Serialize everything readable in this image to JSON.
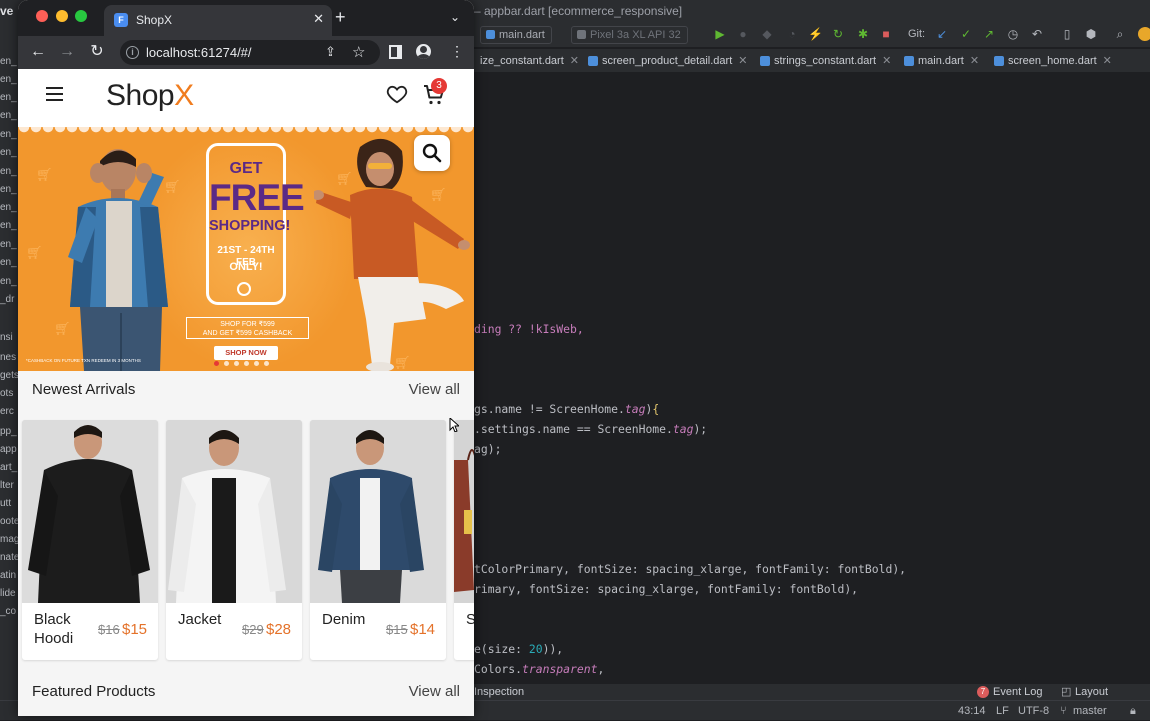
{
  "ide": {
    "title_left": "ve",
    "title": "– appbar.dart [ecommerce_responsive]",
    "run_config": "main.dart",
    "device": "Pixel 3a XL API 32",
    "git_label": "Git:",
    "tabs": [
      "ize_constant.dart",
      "screen_product_detail.dart",
      "strings_constant.dart",
      "main.dart",
      "screen_home.dart"
    ],
    "left_rows": [
      "en_",
      "en_",
      "en_",
      "en_",
      "en_",
      "en_",
      "en_",
      "en_",
      "en_",
      "en_",
      "en_",
      "en_",
      "en_",
      "_dr",
      "",
      "nsi",
      "nes",
      "gets",
      "ots",
      "erc",
      "pp_",
      "app",
      "art_",
      "lter",
      "utt",
      "oote",
      "mag",
      "nate",
      "atin",
      "lide",
      "_co"
    ],
    "code_lines": [
      {
        "parts": [
          [
            "ding ?? !kIsWeb,",
            "k-purple",
            ""
          ]
        ]
      },
      {
        "parts": [
          [
            "gs.name != ScreenHome.",
            ""
          ],
          [
            "tag",
            "k-it"
          ],
          [
            ")",
            ""
          ],
          [
            "{",
            "k-yel"
          ]
        ]
      },
      {
        "parts": [
          [
            ".settings.name == ScreenHome.",
            ""
          ],
          [
            "tag",
            "k-it"
          ],
          [
            ");",
            ""
          ]
        ]
      },
      {
        "parts": [
          [
            "ag);",
            ""
          ]
        ]
      },
      {
        "parts": [
          [
            "tColorPrimary, fontSize: spacing_xlarge, fontFamily: fontBold),",
            ""
          ]
        ]
      },
      {
        "parts": [
          [
            "rimary, fontSize: spacing_xlarge, fontFamily: fontBold),",
            ""
          ]
        ]
      },
      {
        "parts": [
          [
            "e(size: ",
            ""
          ],
          [
            "20",
            "k-num"
          ],
          [
            ")),",
            ""
          ]
        ]
      },
      {
        "parts": [
          [
            "Colors.",
            ""
          ],
          [
            "transparent",
            "k-it"
          ],
          [
            ",",
            ""
          ]
        ]
      }
    ],
    "bottom_tab": "Inspection",
    "event_log_count": "7",
    "event_log": "Event Log",
    "layout_inspector": "Layout Inspector",
    "status": {
      "pos": "43:14",
      "eol": "LF",
      "encoding": "UTF-8",
      "branch": "master"
    }
  },
  "browser": {
    "tab_title": "ShopX",
    "url": "localhost:61274/#/"
  },
  "app": {
    "logo_main": "Shop",
    "logo_accent": "X",
    "cart_count": "3",
    "banner": {
      "get": "GET",
      "free": "FREE",
      "shopping": "SHOPPING!",
      "date": "21ST - 24TH FEB",
      "only": "ONLY!",
      "cashback_line1": "SHOP FOR ₹599",
      "cashback_line2": "AND GET ₹599 CASHBACK",
      "shop_now": "SHOP NOW",
      "fine_print": "*CASHBACK ON FUTURE TXN REDEEM IN 3 MONTHS"
    },
    "newest_title": "Newest Arrivals",
    "view_all": "View all",
    "featured_title": "Featured Products",
    "products": [
      {
        "name": "Black Hoodi",
        "old_price": "$16",
        "price": "$15",
        "color": "#1c1c1c"
      },
      {
        "name": "Jacket",
        "old_price": "$29",
        "price": "$28",
        "color": "#f4f4f4"
      },
      {
        "name": "Denim",
        "old_price": "$15",
        "price": "$14",
        "color": "#2e4a6b"
      },
      {
        "name": "S",
        "old_price": "",
        "price": "",
        "color": "#8a3b2a"
      }
    ]
  },
  "colors": {
    "accent": "#f07c1e",
    "price": "#e4722a",
    "badge": "#e53935",
    "banner": "#f2972d",
    "purple": "#5b2a86"
  }
}
